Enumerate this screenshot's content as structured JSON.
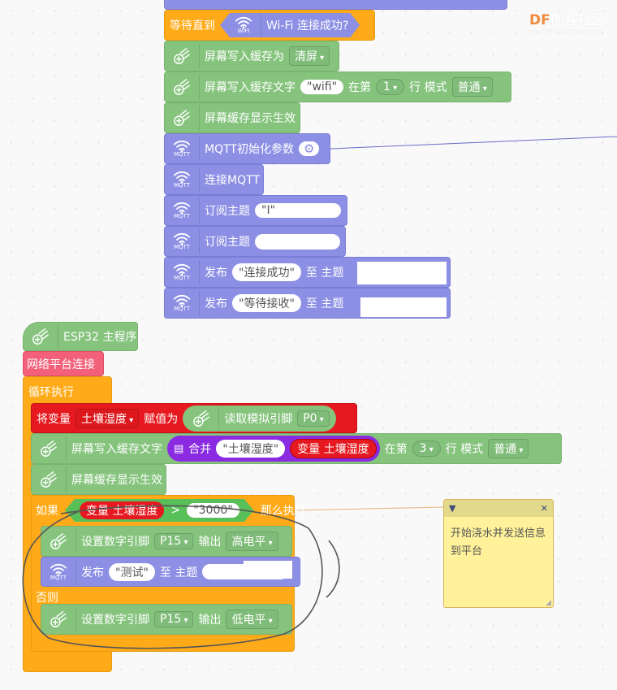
{
  "watermark": {
    "brand": "DF",
    "name": "创客社区",
    "url": "mc.DFRobot.com.cn"
  },
  "top": {
    "wait_label": "等待直到",
    "wifi_icon_label": "WIFI",
    "wifi_cond": "Wi-Fi 连接成功?",
    "oled1": "屏幕写入缓存为",
    "oled1_opt": "清屏",
    "oled2": "屏幕写入缓存文字",
    "oled2_text": "wifi",
    "oled2_at": "在第",
    "oled2_row": "1",
    "oled2_row_lbl": "行 模式",
    "oled2_mode": "普通",
    "oled3": "屏幕缓存显示生效",
    "mqtt_icon_label": "MQTT",
    "mqtt_init": "MQTT初始化参数",
    "mqtt_connect": "连接MQTT",
    "subscribe": "订阅主题",
    "publish": "发布",
    "to_topic": "至 主题",
    "pub1_msg": "连接成功",
    "pub2_msg": "等待接收",
    "sub1_topic": "I"
  },
  "main": {
    "hat": "ESP32 主程序",
    "net": "网络平台连接",
    "loop": "循环执行",
    "set_var": "将变量",
    "var_name": "土壤湿度",
    "assign": "赋值为",
    "read_analog": "读取模拟引脚",
    "pin_p0": "P0",
    "oled_text": "屏幕写入缓存文字",
    "join": "合并",
    "join_str": "土壤湿度",
    "var_reporter": "变量 土壤湿度",
    "at": "在第",
    "row": "3",
    "row_lbl": "行 模式",
    "mode": "普通",
    "oled_show": "屏幕缓存显示生效",
    "if": "如果",
    "cmp_op": ">",
    "cmp_val": "3000",
    "then": "那么执行",
    "set_pin": "设置数字引脚",
    "pin": "P15",
    "output": "输出",
    "high": "高电平",
    "low": "低电平",
    "publish": "发布",
    "pub_msg": "测试",
    "to_topic": "至 主题",
    "else": "否则"
  },
  "comment": {
    "text": "开始浇水并发送信息到平台"
  },
  "colors": {
    "green": "#86c47e",
    "purple": "#8c8fe4",
    "orange": "#ffab19",
    "red": "#e5191f",
    "pink": "#f2607a",
    "note": "#fff29a"
  }
}
